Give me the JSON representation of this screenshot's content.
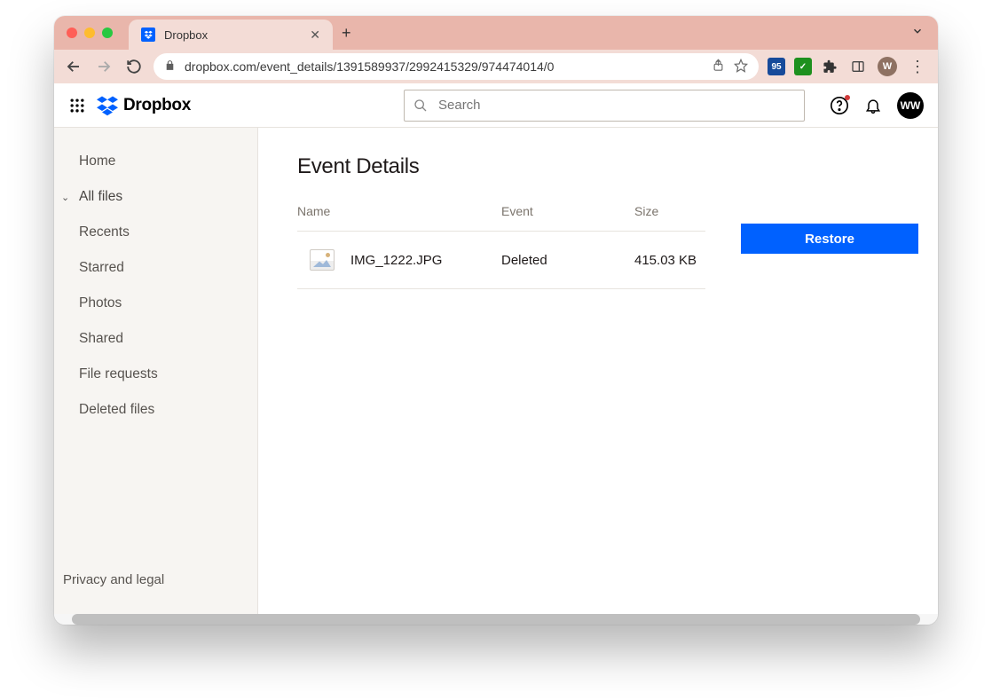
{
  "browser": {
    "tab_title": "Dropbox",
    "url": "dropbox.com/event_details/1391589937/2992415329/974474014/0",
    "profile_initial": "W",
    "ext_label": "95"
  },
  "header": {
    "brand": "Dropbox",
    "search_placeholder": "Search",
    "user_initials": "WW"
  },
  "sidebar": {
    "items": [
      {
        "label": "Home"
      },
      {
        "label": "All files"
      },
      {
        "label": "Recents"
      },
      {
        "label": "Starred"
      },
      {
        "label": "Photos"
      },
      {
        "label": "Shared"
      },
      {
        "label": "File requests"
      },
      {
        "label": "Deleted files"
      }
    ],
    "footer": "Privacy and legal"
  },
  "main": {
    "title": "Event Details",
    "columns": {
      "name": "Name",
      "event": "Event",
      "size": "Size"
    },
    "rows": [
      {
        "name": "IMG_1222.JPG",
        "event": "Deleted",
        "size": "415.03 KB"
      }
    ],
    "restore_label": "Restore"
  }
}
